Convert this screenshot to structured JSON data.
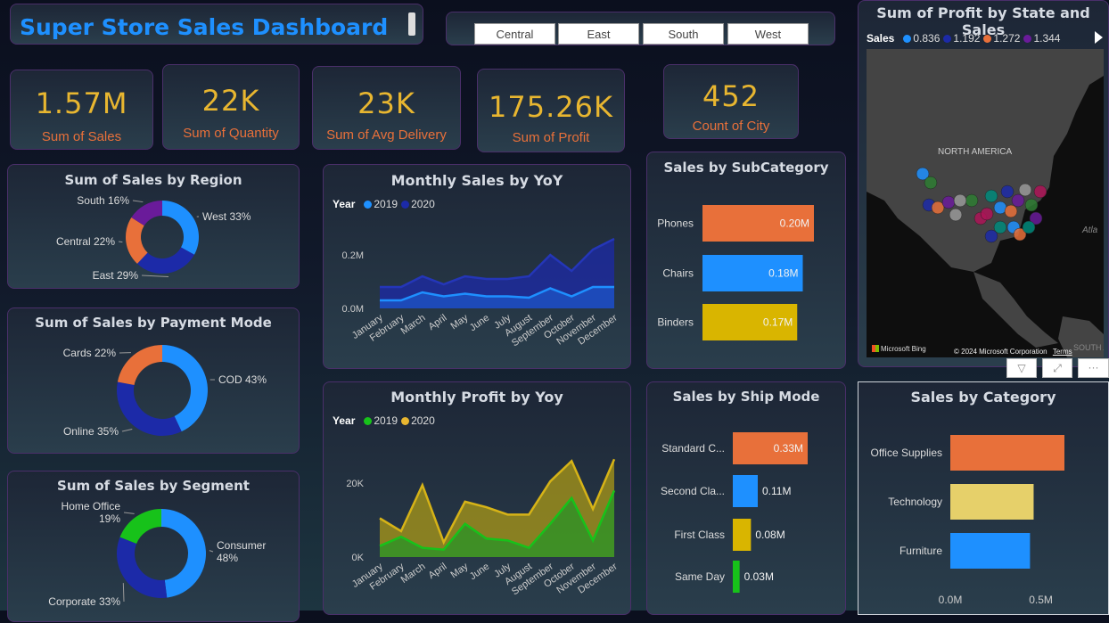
{
  "header": {
    "title": "Super Store Sales Dashboard"
  },
  "slicer": {
    "options": [
      "Central",
      "East",
      "South",
      "West"
    ]
  },
  "kpis": [
    {
      "value": "1.57M",
      "label": "Sum of Sales"
    },
    {
      "value": "22K",
      "label": "Sum of Quantity"
    },
    {
      "value": "23K",
      "label": "Sum of Avg Delivery"
    },
    {
      "value": "175.26K",
      "label": "Sum of Profit"
    },
    {
      "value": "452",
      "label": "Count of City"
    }
  ],
  "colors": {
    "blue": "#1e90ff",
    "navy": "#1c2aa8",
    "orange": "#e8703a",
    "purple": "#6a1b9a",
    "green": "#17c21a",
    "yellow": "#d9b500",
    "lightyellow": "#e6d06a",
    "kpi": "#e8b630"
  },
  "map": {
    "title": "Sum of Profit by State and Sales",
    "legend_title": "Sales",
    "legend_items": [
      "0.836",
      "1.192",
      "1.272",
      "1.344"
    ],
    "region_label": "NORTH AMERICA",
    "ocean_label": "Atla",
    "south_label": "SOUTH AM",
    "bing": "Microsoft Bing",
    "copyright": "© 2024 Microsoft Corporation",
    "terms": "Terms"
  },
  "chart_data": [
    {
      "type": "pie",
      "title": "Sum of Sales by Region",
      "categories": [
        "West",
        "East",
        "Central",
        "South"
      ],
      "values": [
        33,
        29,
        22,
        16
      ],
      "labels": [
        "West 33%",
        "East 29%",
        "Central 22%",
        "South 16%"
      ]
    },
    {
      "type": "pie",
      "title": "Sum of Sales by Payment Mode",
      "categories": [
        "COD",
        "Online",
        "Cards"
      ],
      "values": [
        43,
        35,
        22
      ],
      "labels": [
        "COD 43%",
        "Online 35%",
        "Cards 22%"
      ]
    },
    {
      "type": "pie",
      "title": "Sum of Sales by Segment",
      "categories": [
        "Consumer",
        "Corporate",
        "Home Office"
      ],
      "values": [
        48,
        33,
        19
      ],
      "labels": [
        [
          "Consumer",
          "48%"
        ],
        [
          "Corporate 33%"
        ],
        [
          "Home Office",
          "19%"
        ]
      ]
    },
    {
      "type": "area",
      "title": "Monthly Sales by YoY",
      "legend_title": "Year",
      "categories": [
        "January",
        "February",
        "March",
        "April",
        "May",
        "June",
        "July",
        "August",
        "September",
        "October",
        "November",
        "December"
      ],
      "series": [
        {
          "name": "2019",
          "values": [
            0.03,
            0.03,
            0.06,
            0.045,
            0.055,
            0.045,
            0.045,
            0.04,
            0.075,
            0.045,
            0.08,
            0.08
          ]
        },
        {
          "name": "2020",
          "values": [
            0.08,
            0.08,
            0.12,
            0.09,
            0.12,
            0.11,
            0.11,
            0.12,
            0.2,
            0.14,
            0.22,
            0.26
          ]
        }
      ],
      "yticks": [
        "0.0M",
        "0.2M"
      ],
      "ylim": [
        0,
        0.27
      ]
    },
    {
      "type": "area",
      "title": "Monthly Profit by Yoy",
      "legend_title": "Year",
      "categories": [
        "January",
        "February",
        "March",
        "April",
        "May",
        "June",
        "July",
        "August",
        "September",
        "October",
        "November",
        "December"
      ],
      "series": [
        {
          "name": "2019",
          "values": [
            3000,
            5500,
            2500,
            2000,
            9000,
            5000,
            4500,
            2500,
            9000,
            16000,
            4500,
            18000
          ]
        },
        {
          "name": "2020",
          "values": [
            10500,
            7000,
            19500,
            4000,
            15000,
            13500,
            11500,
            11500,
            20500,
            26000,
            13000,
            26500
          ]
        }
      ],
      "yticks": [
        "0K",
        "20K"
      ],
      "ylim": [
        0,
        28000
      ]
    },
    {
      "type": "bar",
      "title": "Sales by SubCategory",
      "categories": [
        "Phones",
        "Chairs",
        "Binders"
      ],
      "values": [
        0.2,
        0.18,
        0.17
      ],
      "labels": [
        "0.20M",
        "0.18M",
        "0.17M"
      ]
    },
    {
      "type": "bar",
      "title": "Sales by Ship Mode",
      "categories": [
        "Standard C...",
        "Second Cla...",
        "First Class",
        "Same Day"
      ],
      "values": [
        0.33,
        0.11,
        0.08,
        0.03
      ],
      "labels": [
        "0.33M",
        "0.11M",
        "0.08M",
        "0.03M"
      ]
    },
    {
      "type": "bar",
      "title": "Sales by Category",
      "categories": [
        "Office Supplies",
        "Technology",
        "Furniture"
      ],
      "values": [
        0.63,
        0.46,
        0.44
      ],
      "xticks": [
        "0.0M",
        "0.5M"
      ]
    }
  ]
}
